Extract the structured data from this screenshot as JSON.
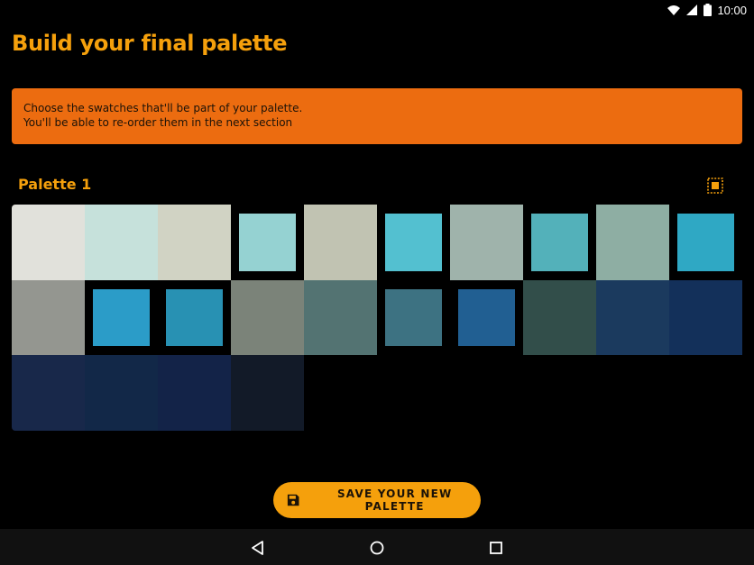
{
  "status_bar": {
    "time": "10:00",
    "icons": [
      "wifi-icon",
      "signal-icon",
      "battery-icon"
    ]
  },
  "title": "Build your final palette",
  "banner": {
    "line1": "Choose the swatches that'll be part of your palette.",
    "line2": "You'll be able to re-order them in the next section"
  },
  "palette": {
    "name": "Palette 1",
    "swatches": [
      {
        "color": "#e1e1db",
        "selected": true
      },
      {
        "color": "#c6e1db",
        "selected": true
      },
      {
        "color": "#d1d3c4",
        "selected": true
      },
      {
        "color": "#95d2d2",
        "selected": false
      },
      {
        "color": "#c1c3b2",
        "selected": true
      },
      {
        "color": "#53c0d0",
        "selected": false
      },
      {
        "color": "#9fb3ab",
        "selected": true
      },
      {
        "color": "#53b1ba",
        "selected": false
      },
      {
        "color": "#8eaea3",
        "selected": true
      },
      {
        "color": "#2fa8c4",
        "selected": false
      },
      {
        "color": "#949690",
        "selected": true
      },
      {
        "color": "#2b9cc8",
        "selected": false
      },
      {
        "color": "#2891b3",
        "selected": false
      },
      {
        "color": "#7b8379",
        "selected": true
      },
      {
        "color": "#537372",
        "selected": true
      },
      {
        "color": "#3d7282",
        "selected": false
      },
      {
        "color": "#215f92",
        "selected": false
      },
      {
        "color": "#324e4a",
        "selected": true
      },
      {
        "color": "#1b3a5e",
        "selected": true
      },
      {
        "color": "#13305a",
        "selected": true
      },
      {
        "color": "#18284a",
        "selected": true
      },
      {
        "color": "#122848",
        "selected": true
      },
      {
        "color": "#132348",
        "selected": true
      },
      {
        "color": "#121a28",
        "selected": true
      }
    ]
  },
  "save_button": {
    "label": "SAVE YOUR NEW PALETTE"
  },
  "colors": {
    "accent": "#f5a00c",
    "banner": "#ec6c10"
  }
}
